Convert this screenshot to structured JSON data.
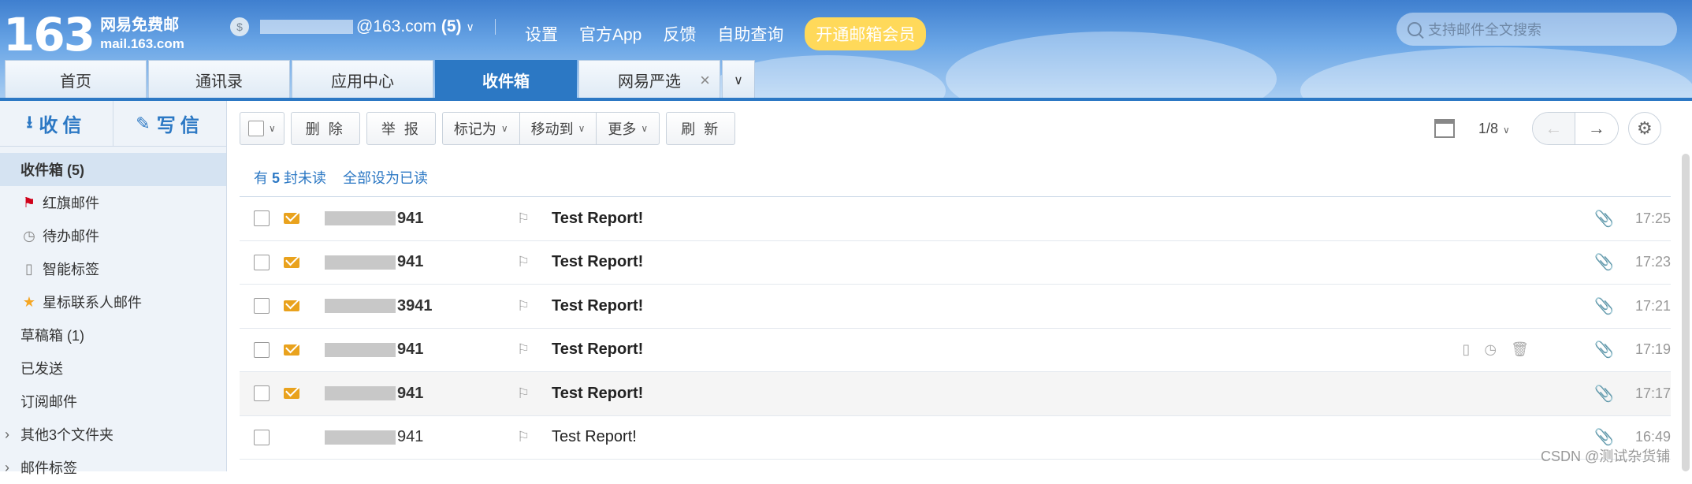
{
  "brand": {
    "number": "163",
    "cn": "网易免费邮",
    "url": "mail.163.com"
  },
  "account": {
    "email": "@163.com",
    "unread": "(5)",
    "coin_icon": "$"
  },
  "top_links": [
    "设置",
    "官方App",
    "反馈",
    "自助查询"
  ],
  "vip_button": "开通邮箱会员",
  "search": {
    "placeholder": "支持邮件全文搜索"
  },
  "tabs": [
    {
      "label": "首页"
    },
    {
      "label": "通讯录"
    },
    {
      "label": "应用中心"
    },
    {
      "label": "收件箱"
    },
    {
      "label": "网易严选"
    }
  ],
  "sidebar": {
    "receive": "收信",
    "compose": "写信",
    "folders": [
      {
        "label": "收件箱 (5)"
      },
      {
        "label": "红旗邮件"
      },
      {
        "label": "待办邮件"
      },
      {
        "label": "智能标签"
      },
      {
        "label": "星标联系人邮件"
      },
      {
        "label": "草稿箱 (1)"
      },
      {
        "label": "已发送"
      },
      {
        "label": "订阅邮件"
      },
      {
        "label": "其他3个文件夹"
      },
      {
        "label": "邮件标签"
      }
    ]
  },
  "toolbar": {
    "delete": "删 除",
    "report": "举 报",
    "mark_as": "标记为",
    "move_to": "移动到",
    "more": "更多",
    "refresh": "刷 新",
    "page": "1/8"
  },
  "unread_bar": {
    "prefix": "有",
    "count": "5",
    "suffix": "封未读",
    "mark_all": "全部设为已读"
  },
  "messages": [
    {
      "sender": "941",
      "subject": "Test Report!",
      "time": "17:25"
    },
    {
      "sender": "941",
      "subject": "Test Report!",
      "time": "17:23"
    },
    {
      "sender": "3941",
      "subject": "Test Report!",
      "time": "17:21"
    },
    {
      "sender": "941",
      "subject": "Test Report!",
      "time": "17:19"
    },
    {
      "sender": "941",
      "subject": "Test Report!",
      "time": "17:17"
    },
    {
      "sender": "941",
      "subject": "Test Report!",
      "time": "16:49"
    }
  ],
  "watermark": "CSDN @测试杂货铺"
}
